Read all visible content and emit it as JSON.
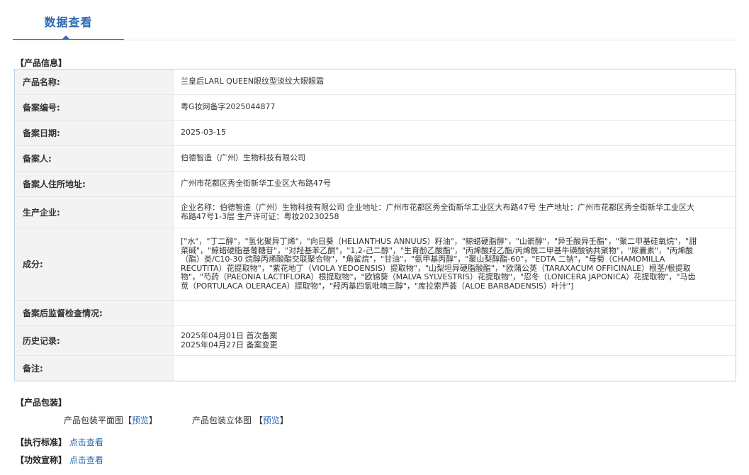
{
  "tab": {
    "title": "数据查看"
  },
  "product_info": {
    "heading": "【产品信息】",
    "rows": [
      {
        "key": "产品名称:",
        "value": "兰皇后LARL QUEEN眼纹型淡纹大眼眼霜"
      },
      {
        "key": "备案编号:",
        "value": "粤G妆网备字2025044877"
      },
      {
        "key": "备案日期:",
        "value": "2025-03-15"
      },
      {
        "key": "备案人:",
        "value": "伯德智造（广州）生物科技有限公司"
      },
      {
        "key": "备案人住所地址:",
        "value": "广州市花都区秀全街新华工业区大布路47号"
      },
      {
        "key": "生产企业:",
        "value": "企业名称：伯德智造（广州）生物科技有限公司 企业地址：广州市花都区秀全街新华工业区大布路47号 生产地址：广州市花都区秀全街新华工业区大布路47号1-3层 生产许可证：粤妆20230258"
      },
      {
        "key": "成分:",
        "value": "[\"水\"，\"丁二醇\"，\"氢化聚异丁烯\"，\"向日葵（HELIANTHUS ANNUUS）籽油\"，\"鲸蜡硬脂醇\"，\"山嵛醇\"，\"异壬酸异壬酯\"，\"聚二甲基硅氧烷\"，\"甜菜碱\"，\"鲸蜡硬脂基葡糖苷\"，\"对羟基苯乙酮\"，\"1,2-己二醇\"，\"生育酚乙酸酯\"，\"丙烯酸羟乙酯/丙烯酰二甲基牛磺酸钠共聚物\"，\"尿囊素\"，\"丙烯酸（酯）类/C10-30 烷醇丙烯酸酯交联聚合物\"，\"角鲨烷\"，\"甘油\"，\"氨甲基丙醇\"，\"聚山梨醇酯-60\"，\"EDTA 二钠\"，\"母菊（CHAMOMILLA RECUTITA）花提取物\"，\"紫花地丁（VIOLA YEDOENSIS）提取物\"，\"山梨坦异硬脂酸酯\"，\"欧蒲公英（TARAXACUM OFFICINALE）根茎/根提取物\"，\"芍药（PAEONIA LACTIFLORA）根提取物\"，\"欧锦葵（MALVA SYLVESTRIS）花提取物\"，\"忍冬（LONICERA JAPONICA）花提取物\"，\"马齿苋（PORTULACA OLERACEA）提取物\"，\"羟丙基四氢吡喃三醇\"，\"库拉索芦荟（ALOE BARBADENSIS）叶汁\"]"
      },
      {
        "key": "备案后监督检查情况:",
        "value": ""
      },
      {
        "key": "历史记录:",
        "value_lines": [
          "2025年04月01日 首次备案",
          "2025年04月27日 备案变更"
        ]
      },
      {
        "key": "备注:",
        "value": ""
      }
    ]
  },
  "packaging": {
    "heading": "【产品包装】",
    "flat_label": "产品包装平面图",
    "solid_label": "产品包装立体图",
    "bracket_open": "【",
    "bracket_close": "】",
    "preview_link": "预览"
  },
  "standard": {
    "label": "【执行标准】",
    "link": "点击查看"
  },
  "efficacy": {
    "label": "【功效宣称】",
    "link": "点击查看"
  },
  "colors": {
    "accent": "#2a6ab1",
    "table_border": "#b8cfe6",
    "key_bg": "#f3f3f3"
  }
}
